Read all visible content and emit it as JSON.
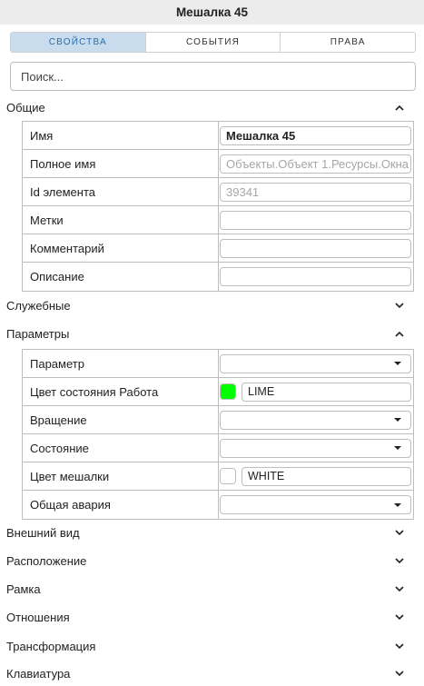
{
  "window": {
    "title": "Мешалка 45"
  },
  "tabs": [
    {
      "label": "СВОЙСТВА",
      "active": true
    },
    {
      "label": "СОБЫТИЯ",
      "active": false
    },
    {
      "label": "ПРАВА",
      "active": false
    }
  ],
  "search": {
    "placeholder": "Поиск..."
  },
  "sections": {
    "general": {
      "label": "Общие",
      "expanded": true,
      "rows": [
        {
          "name": "Имя",
          "value": "Мешалка 45"
        },
        {
          "name": "Полное имя",
          "value": "Объекты.Объект 1.Ресурсы.Окна"
        },
        {
          "name": "Id элемента",
          "value": "39341"
        },
        {
          "name": "Метки",
          "value": ""
        },
        {
          "name": "Комментарий",
          "value": ""
        },
        {
          "name": "Описание",
          "value": ""
        }
      ]
    },
    "service": {
      "label": "Служебные",
      "expanded": false
    },
    "parameters": {
      "label": "Параметры",
      "expanded": true,
      "rows": [
        {
          "name": "Параметр",
          "value": ""
        },
        {
          "name": "Цвет состояния Работа",
          "value": "LIME",
          "color": "#00ff00"
        },
        {
          "name": "Вращение",
          "value": ""
        },
        {
          "name": "Состояние",
          "value": ""
        },
        {
          "name": "Цвет мешалки",
          "value": "WHITE",
          "color": "#ffffff"
        },
        {
          "name": "Общая авария",
          "value": ""
        }
      ]
    },
    "appearance": {
      "label": "Внешний вид",
      "expanded": false
    },
    "position": {
      "label": "Расположение",
      "expanded": false
    },
    "frame": {
      "label": "Рамка",
      "expanded": false
    },
    "relations": {
      "label": "Отношения",
      "expanded": false
    },
    "transform": {
      "label": "Трансформация",
      "expanded": false
    },
    "keyboard": {
      "label": "Клавиатура",
      "expanded": false
    }
  },
  "colors": {
    "active_tab_bg": "#c8dced",
    "active_tab_text": "#2a6ea8",
    "titlebar_bg": "#ececec"
  }
}
